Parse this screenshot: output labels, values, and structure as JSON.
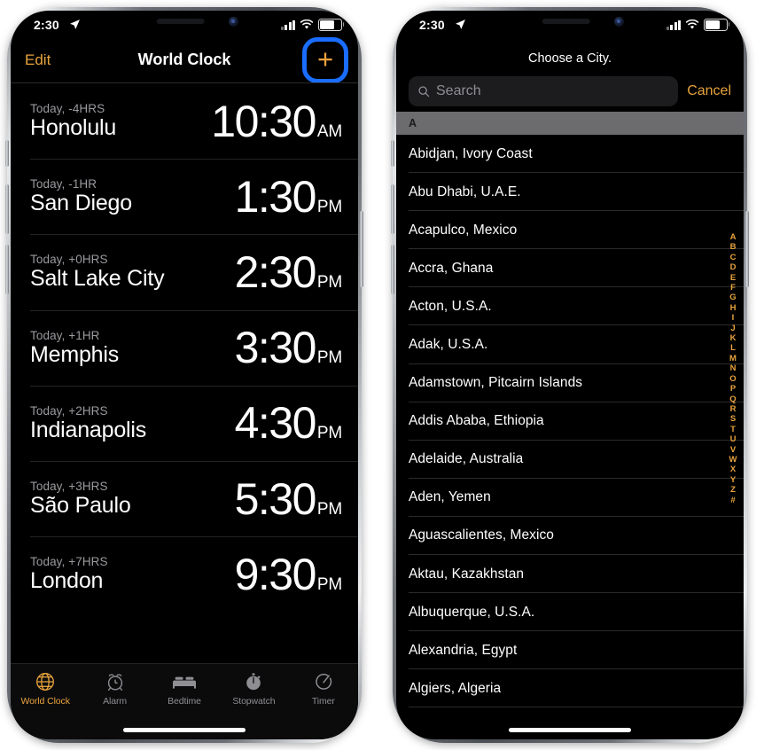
{
  "left_phone": {
    "status_bar": {
      "time": "2:30",
      "location_icon": "location-arrow-icon",
      "signal_icon": "cellular-signal-icon",
      "wifi_icon": "wifi-icon",
      "battery_icon": "battery-icon"
    },
    "nav": {
      "edit_label": "Edit",
      "title": "World Clock",
      "add_label": "+",
      "add_icon": "plus-icon",
      "highlight_color": "#1a6dff"
    },
    "accent_color": "#e8a33d",
    "clocks": [
      {
        "offset": "Today, -4HRS",
        "city": "Honolulu",
        "time": "10:30",
        "meridiem": "AM"
      },
      {
        "offset": "Today, -1HR",
        "city": "San Diego",
        "time": "1:30",
        "meridiem": "PM"
      },
      {
        "offset": "Today, +0HRS",
        "city": "Salt Lake City",
        "time": "2:30",
        "meridiem": "PM"
      },
      {
        "offset": "Today, +1HR",
        "city": "Memphis",
        "time": "3:30",
        "meridiem": "PM"
      },
      {
        "offset": "Today, +2HRS",
        "city": "Indianapolis",
        "time": "4:30",
        "meridiem": "PM"
      },
      {
        "offset": "Today, +3HRS",
        "city": "São Paulo",
        "time": "5:30",
        "meridiem": "PM"
      },
      {
        "offset": "Today, +7HRS",
        "city": "London",
        "time": "9:30",
        "meridiem": "PM"
      }
    ],
    "tabs": [
      {
        "label": "World Clock",
        "icon": "globe-icon",
        "active": true
      },
      {
        "label": "Alarm",
        "icon": "alarm-clock-icon",
        "active": false
      },
      {
        "label": "Bedtime",
        "icon": "bed-icon",
        "active": false
      },
      {
        "label": "Stopwatch",
        "icon": "stopwatch-icon",
        "active": false
      },
      {
        "label": "Timer",
        "icon": "timer-icon",
        "active": false
      }
    ]
  },
  "right_phone": {
    "status_bar": {
      "time": "2:30",
      "location_icon": "location-arrow-icon",
      "signal_icon": "cellular-signal-icon",
      "wifi_icon": "wifi-icon",
      "battery_icon": "battery-icon"
    },
    "title": "Choose a City.",
    "search": {
      "placeholder": "Search",
      "value": "",
      "icon": "search-icon"
    },
    "cancel_label": "Cancel",
    "section_header": "A",
    "cities": [
      "Abidjan, Ivory Coast",
      "Abu Dhabi, U.A.E.",
      "Acapulco, Mexico",
      "Accra, Ghana",
      "Acton, U.S.A.",
      "Adak, U.S.A.",
      "Adamstown, Pitcairn Islands",
      "Addis Ababa, Ethiopia",
      "Adelaide, Australia",
      "Aden, Yemen",
      "Aguascalientes, Mexico",
      "Aktau, Kazakhstan",
      "Albuquerque, U.S.A.",
      "Alexandria, Egypt",
      "Algiers, Algeria"
    ],
    "index_letters": [
      "A",
      "B",
      "C",
      "D",
      "E",
      "F",
      "G",
      "H",
      "I",
      "J",
      "K",
      "L",
      "M",
      "N",
      "O",
      "P",
      "Q",
      "R",
      "S",
      "T",
      "U",
      "V",
      "W",
      "X",
      "Y",
      "Z",
      "#"
    ]
  }
}
